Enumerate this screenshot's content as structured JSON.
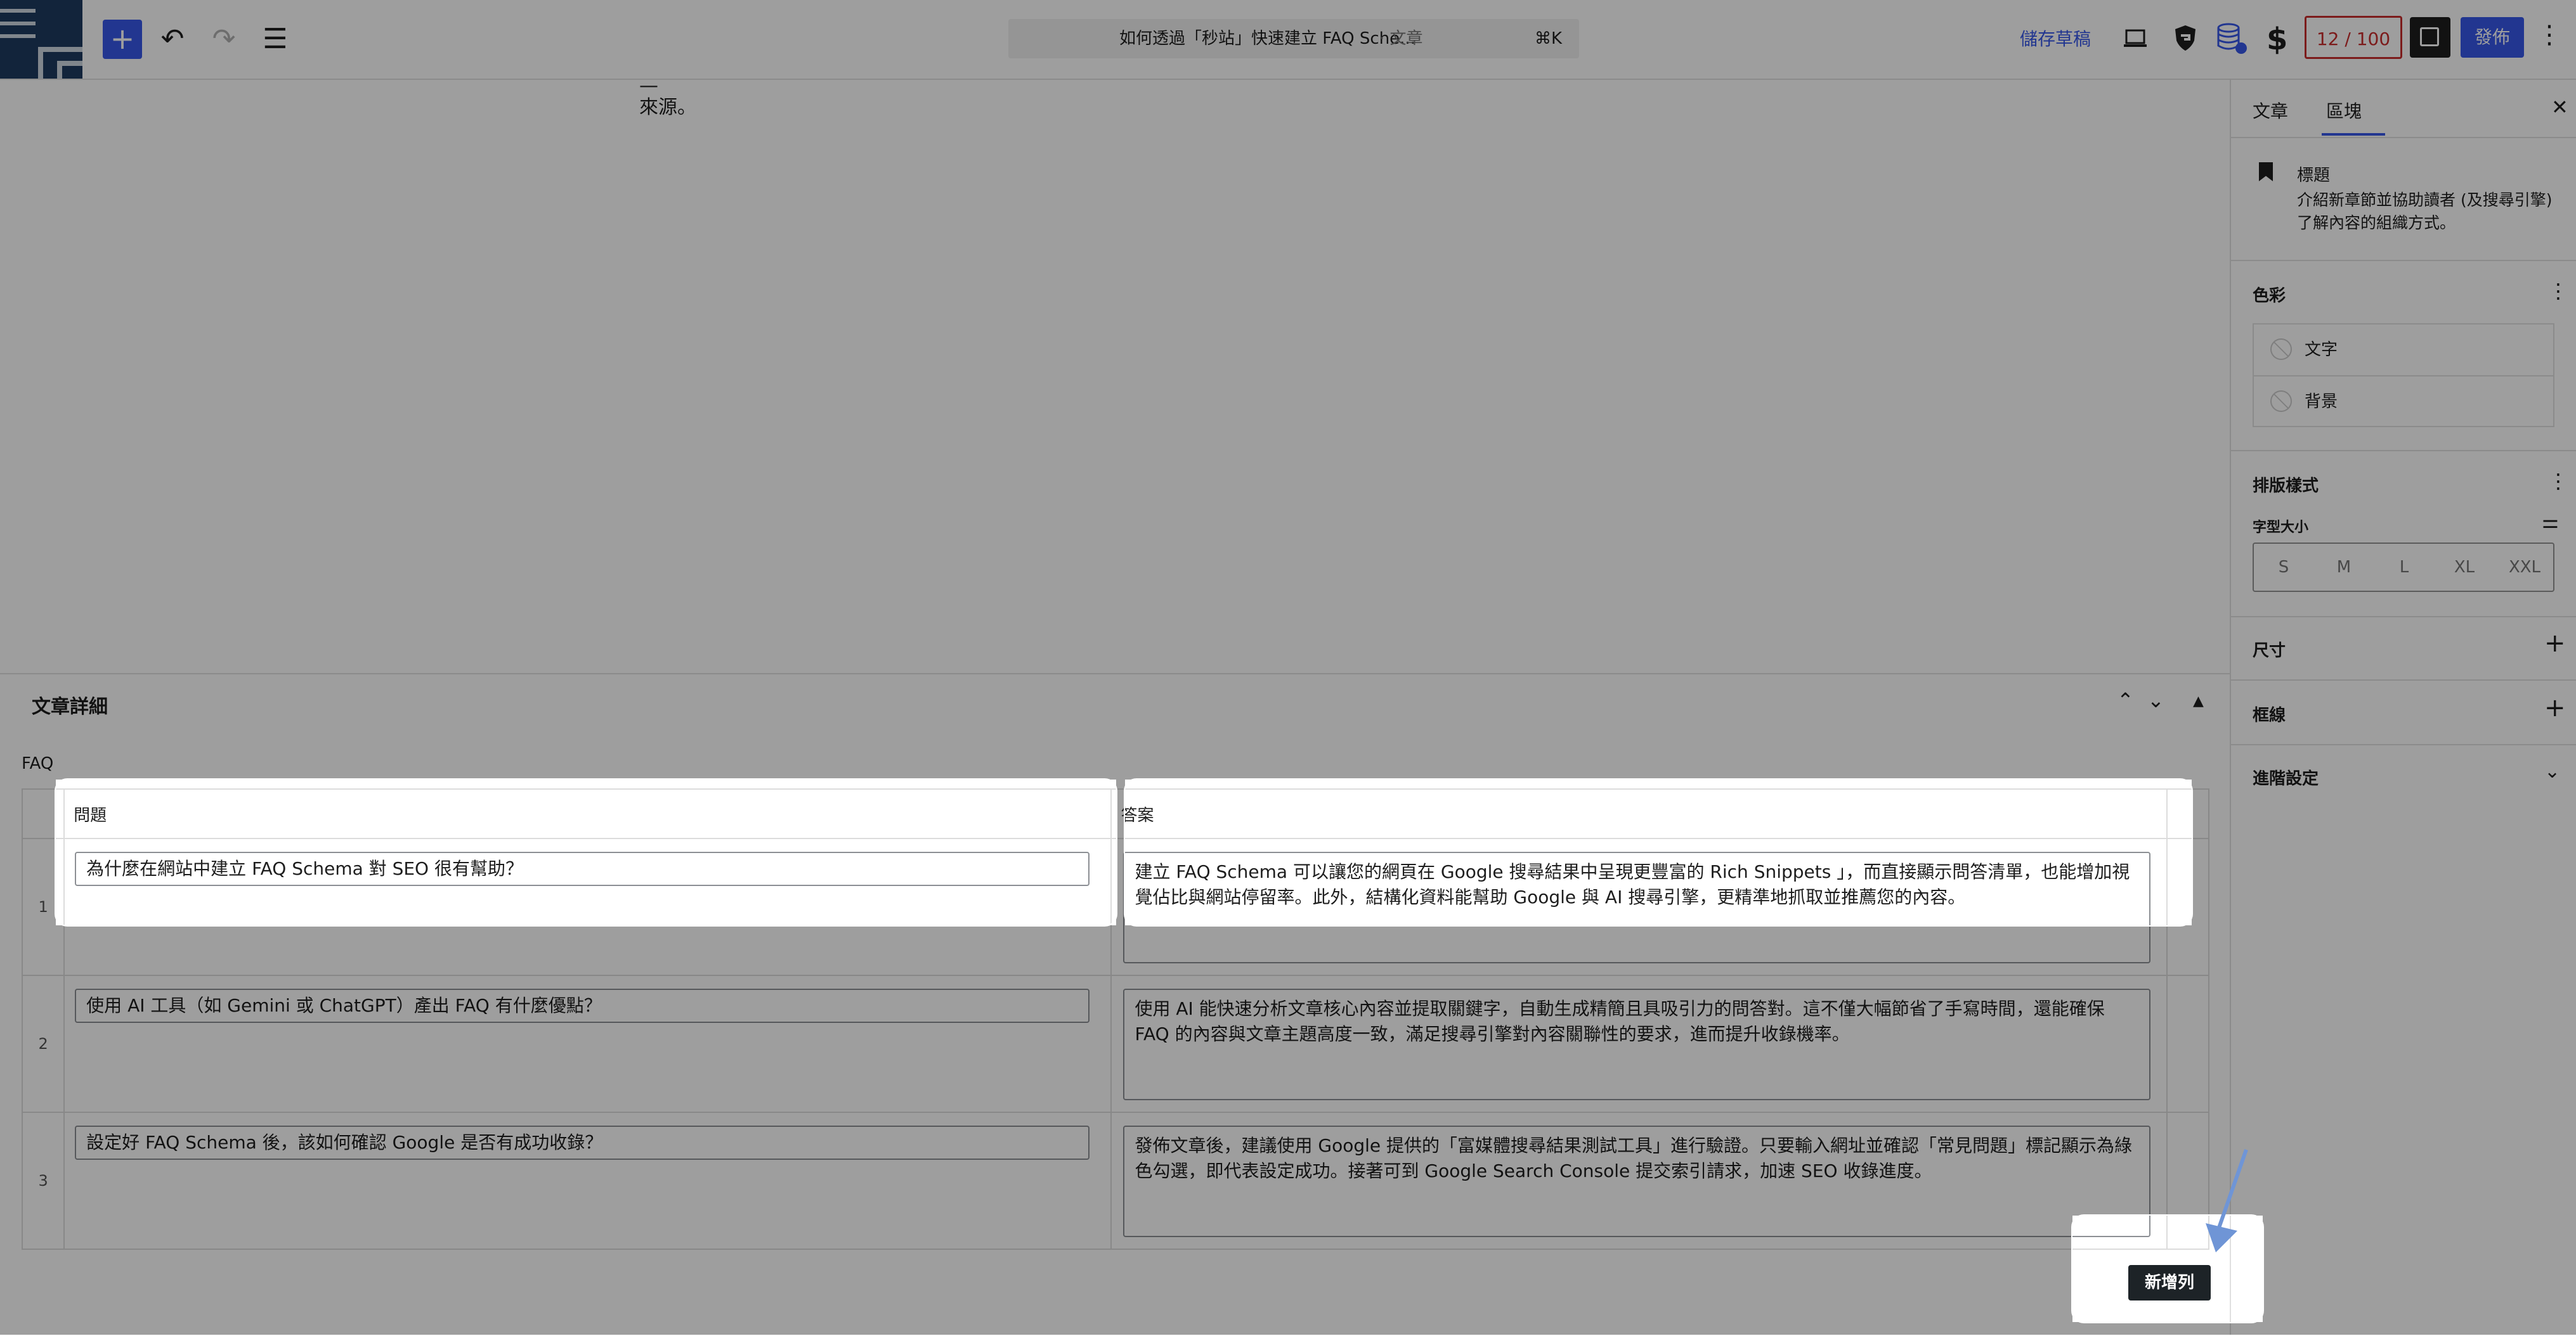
{
  "topbar": {
    "doc_title": "如何透過「秒站」快速建立 FAQ Sche...",
    "doc_type": "· 文章",
    "shortcut": "⌘K",
    "save_draft": "儲存草稿",
    "seo_score": "12 / 100",
    "publish": "發佈"
  },
  "canvas": {
    "text_tail": "來源。"
  },
  "metabox": {
    "title": "文章詳細",
    "faq_label": "FAQ",
    "col_question": "問題",
    "col_answer": "答案",
    "rows": [
      {
        "num": "1",
        "question": "為什麼在網站中建立 FAQ Schema 對 SEO 很有幫助？",
        "answer": "建立 FAQ Schema 可以讓您的網頁在 Google 搜尋結果中呈現更豐富的 Rich Snippets 」，而直接顯示問答清單，也能增加視覺佔比與網站停留率。此外，結構化資料能幫助 Google 與 AI 搜尋引擎，更精準地抓取並推薦您的內容。"
      },
      {
        "num": "2",
        "question": "使用 AI 工具（如 Gemini 或 ChatGPT）產出 FAQ 有什麼優點？",
        "answer": "使用 AI 能快速分析文章核心內容並提取關鍵字，自動生成精簡且具吸引力的問答對。這不僅大幅節省了手寫時間，還能確保 FAQ 的內容與文章主題高度一致，滿足搜尋引擎對內容關聯性的要求，進而提升收錄機率。"
      },
      {
        "num": "3",
        "question": "設定好 FAQ Schema 後，該如何確認 Google 是否有成功收錄？",
        "answer": "發佈文章後，建議使用 Google 提供的「富媒體搜尋結果測試工具」進行驗證。只要輸入網址並確認「常見問題」標記顯示為綠色勾選，即代表設定成功。接著可到 Google Search Console 提交索引請求，加速 SEO 收錄進度。"
      }
    ],
    "add_row": "新增列"
  },
  "sidebar": {
    "tab_post": "文章",
    "tab_block": "區塊",
    "block_name": "標題",
    "block_desc": "介紹新章節並協助讀者 (及搜尋引擎) 了解內容的組織方式。",
    "color_title": "色彩",
    "color_text": "文字",
    "color_bg": "背景",
    "typo_title": "排版樣式",
    "font_size_label": "字型大小",
    "sizes": [
      "S",
      "M",
      "L",
      "XL",
      "XXL"
    ],
    "dimensions_title": "尺寸",
    "border_title": "框線",
    "advanced_title": "進階設定"
  },
  "colors": {
    "accent": "#3858e9",
    "seo_warning": "#c92c2c",
    "overlay": "rgba(0,0,0,0.38)",
    "arrow": "#6f95d6"
  }
}
